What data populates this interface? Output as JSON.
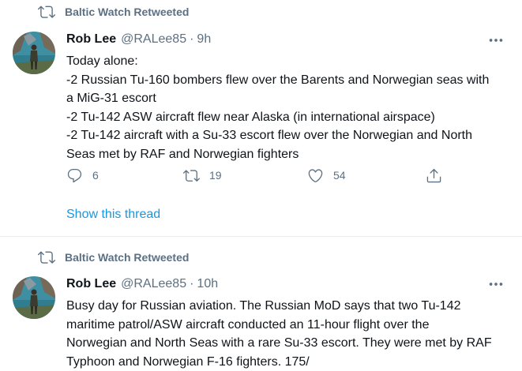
{
  "colors": {
    "muted": "#5b7083",
    "text": "#0f1419",
    "link": "#1b95e0",
    "divider": "#e6ecf0"
  },
  "tweets": [
    {
      "retweet_label": "Baltic Watch Retweeted",
      "name": "Rob Lee",
      "handle": "@RALee85",
      "separator": "·",
      "time": "9h",
      "lines": [
        "Today alone:",
        "-2 Russian Tu-160 bombers flew over the Barents and Norwegian seas with",
        "a MiG-31 escort",
        "-2 Tu-142 ASW aircraft flew near Alaska (in international airspace)",
        "-2 Tu-142 aircraft with a Su-33 escort flew over the Norwegian and North",
        "Seas met by RAF and Norwegian fighters"
      ],
      "reply_count": "6",
      "retweet_count": "19",
      "like_count": "54",
      "show_thread": "Show this thread",
      "icons": [
        "retweet-icon",
        "more-icon",
        "reply-icon",
        "retweet-icon",
        "like-icon",
        "share-icon"
      ]
    },
    {
      "retweet_label": "Baltic Watch Retweeted",
      "name": "Rob Lee",
      "handle": "@RALee85",
      "separator": "·",
      "time": "10h",
      "lines": [
        "Busy day for Russian aviation. The Russian MoD says that two Tu-142",
        "maritime patrol/ASW aircraft conducted an 11-hour flight over the",
        "Norwegian and North Seas with a rare Su-33 escort. They were met by RAF",
        "Typhoon and Norwegian F-16 fighters. 175/"
      ]
    }
  ]
}
